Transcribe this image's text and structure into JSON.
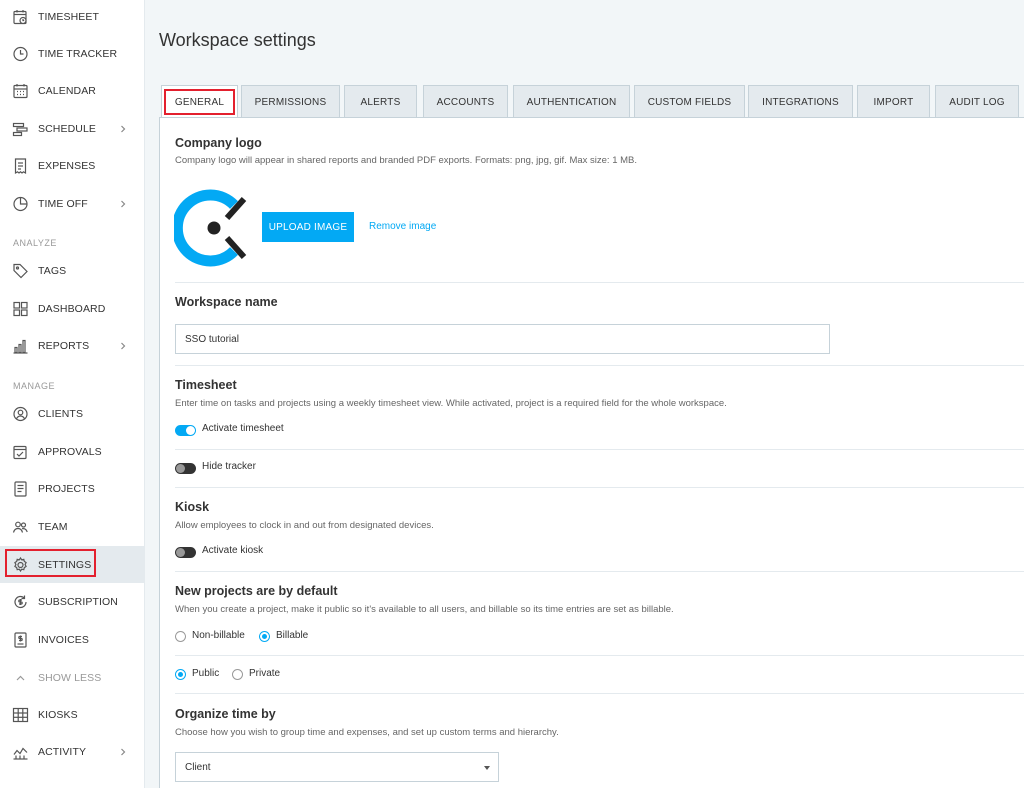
{
  "sidebar": {
    "items": [
      {
        "label": "TIMESHEET",
        "icon": "timesheet-icon"
      },
      {
        "label": "TIME TRACKER",
        "icon": "clock-icon"
      },
      {
        "label": "CALENDAR",
        "icon": "calendar-icon"
      },
      {
        "label": "SCHEDULE",
        "icon": "schedule-icon"
      },
      {
        "label": "EXPENSES",
        "icon": "receipt-icon"
      },
      {
        "label": "TIME OFF",
        "icon": "time-off-icon"
      },
      {
        "label": "TAGS",
        "icon": "tag-icon"
      },
      {
        "label": "DASHBOARD",
        "icon": "dashboard-icon"
      },
      {
        "label": "REPORTS",
        "icon": "reports-icon"
      },
      {
        "label": "CLIENTS",
        "icon": "clients-icon"
      },
      {
        "label": "APPROVALS",
        "icon": "approvals-icon"
      },
      {
        "label": "PROJECTS",
        "icon": "projects-icon"
      },
      {
        "label": "TEAM",
        "icon": "team-icon"
      },
      {
        "label": "SETTINGS",
        "icon": "gear-icon"
      },
      {
        "label": "SUBSCRIPTION",
        "icon": "subscription-icon"
      },
      {
        "label": "INVOICES",
        "icon": "invoices-icon"
      },
      {
        "label": "SHOW LESS",
        "icon": "chevron-up-icon"
      },
      {
        "label": "KIOSKS",
        "icon": "kiosk-icon"
      },
      {
        "label": "ACTIVITY",
        "icon": "activity-icon"
      }
    ],
    "sections": {
      "analyze": "ANALYZE",
      "manage": "MANAGE"
    }
  },
  "page": {
    "title": "Workspace settings"
  },
  "tabs": [
    "GENERAL",
    "PERMISSIONS",
    "ALERTS",
    "ACCOUNTS",
    "AUTHENTICATION",
    "CUSTOM FIELDS",
    "INTEGRATIONS",
    "IMPORT",
    "AUDIT LOG"
  ],
  "logo_section": {
    "title": "Company logo",
    "desc": "Company logo will appear in shared reports and branded PDF exports. Formats: png, jpg, gif. Max size: 1 MB.",
    "upload": "UPLOAD IMAGE",
    "remove": "Remove image"
  },
  "workspace": {
    "title": "Workspace name",
    "value": "SSO tutorial"
  },
  "timesheet": {
    "title": "Timesheet",
    "desc": "Enter time on tasks and projects using a weekly timesheet view. While activated, project is a required field for the whole workspace.",
    "activate": "Activate timesheet",
    "hide_tracker": "Hide tracker"
  },
  "kiosk": {
    "title": "Kiosk",
    "desc": "Allow employees to clock in and out from designated devices.",
    "activate": "Activate kiosk"
  },
  "projects_default": {
    "title": "New projects are by default",
    "desc": "When you create a project, make it public so it's available to all users, and billable so its time entries are set as billable.",
    "non_billable": "Non-billable",
    "billable": "Billable",
    "public": "Public",
    "private": "Private"
  },
  "organize": {
    "title": "Organize time by",
    "desc": "Choose how you wish to group time and expenses, and set up custom terms and hierarchy.",
    "selected": "Client"
  },
  "colors": {
    "accent": "#03a9f4",
    "highlight": "#e3202e"
  }
}
